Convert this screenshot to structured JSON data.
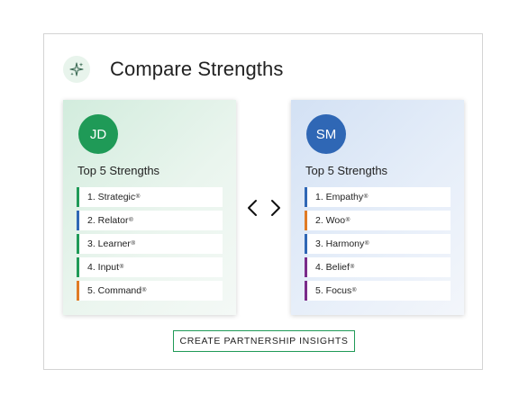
{
  "header": {
    "title": "Compare Strengths",
    "icon": "sparkle-icon"
  },
  "colors": {
    "green": "#1f9a57",
    "blue": "#2f67b5",
    "orange": "#e07b25",
    "purple": "#7b2c8a"
  },
  "left_card": {
    "initials": "JD",
    "heading": "Top 5 Strengths",
    "items": [
      {
        "label": "1. Strategic",
        "mark": "®",
        "color": "teal"
      },
      {
        "label": "2. Relator",
        "mark": "®",
        "color": "blue"
      },
      {
        "label": "3. Learner",
        "mark": "®",
        "color": "teal"
      },
      {
        "label": "4. Input",
        "mark": "®",
        "color": "teal"
      },
      {
        "label": "5. Command",
        "mark": "®",
        "color": "orange"
      }
    ]
  },
  "right_card": {
    "initials": "SM",
    "heading": "Top 5 Strengths",
    "items": [
      {
        "label": "1. Empathy",
        "mark": "®",
        "color": "blue"
      },
      {
        "label": "2. Woo",
        "mark": "®",
        "color": "orange"
      },
      {
        "label": "3. Harmony",
        "mark": "®",
        "color": "blue"
      },
      {
        "label": "4. Belief",
        "mark": "®",
        "color": "purple"
      },
      {
        "label": "5. Focus",
        "mark": "®",
        "color": "purple"
      }
    ]
  },
  "compare_icon": "chevrons-left-right-icon",
  "cta": {
    "label": "CREATE PARTNERSHIP INSIGHTS"
  }
}
